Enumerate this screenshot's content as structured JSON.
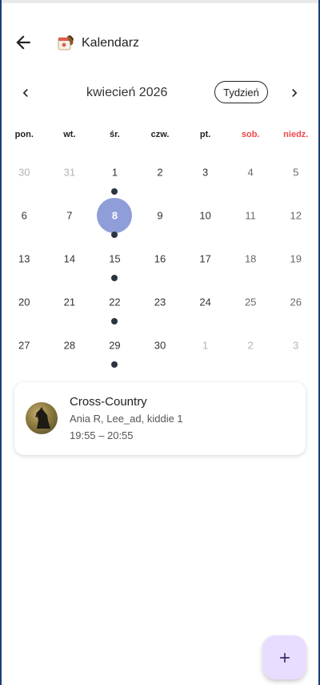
{
  "appbar": {
    "title": "Kalendarz",
    "back_icon": "arrow-back-icon",
    "logo_icon": "calendar-horse-logo"
  },
  "calendar": {
    "month_title": "kwiecień 2026",
    "view_toggle_label": "Tydzień",
    "prev_icon": "chevron-left-icon",
    "next_icon": "chevron-right-icon",
    "weekdays": [
      {
        "label": "pon.",
        "weekend": false
      },
      {
        "label": "wt.",
        "weekend": false
      },
      {
        "label": "śr.",
        "weekend": false
      },
      {
        "label": "czw.",
        "weekend": false
      },
      {
        "label": "pt.",
        "weekend": false
      },
      {
        "label": "sob.",
        "weekend": true
      },
      {
        "label": "niedz.",
        "weekend": true
      }
    ],
    "weeks": [
      [
        {
          "day": "30",
          "muted": true,
          "event": false
        },
        {
          "day": "31",
          "muted": true,
          "event": false
        },
        {
          "day": "1",
          "muted": false,
          "event": true
        },
        {
          "day": "2",
          "muted": false,
          "event": false
        },
        {
          "day": "3",
          "muted": false,
          "event": false
        },
        {
          "day": "4",
          "muted": false,
          "event": false,
          "weekend": true
        },
        {
          "day": "5",
          "muted": false,
          "event": false,
          "weekend": true
        }
      ],
      [
        {
          "day": "6",
          "muted": false,
          "event": false
        },
        {
          "day": "7",
          "muted": false,
          "event": false
        },
        {
          "day": "8",
          "muted": false,
          "event": true,
          "selected": true
        },
        {
          "day": "9",
          "muted": false,
          "event": false
        },
        {
          "day": "10",
          "muted": false,
          "event": false
        },
        {
          "day": "11",
          "muted": false,
          "event": false,
          "weekend": true
        },
        {
          "day": "12",
          "muted": false,
          "event": false,
          "weekend": true
        }
      ],
      [
        {
          "day": "13",
          "muted": false,
          "event": false
        },
        {
          "day": "14",
          "muted": false,
          "event": false
        },
        {
          "day": "15",
          "muted": false,
          "event": true
        },
        {
          "day": "16",
          "muted": false,
          "event": false
        },
        {
          "day": "17",
          "muted": false,
          "event": false
        },
        {
          "day": "18",
          "muted": false,
          "event": false,
          "weekend": true
        },
        {
          "day": "19",
          "muted": false,
          "event": false,
          "weekend": true
        }
      ],
      [
        {
          "day": "20",
          "muted": false,
          "event": false
        },
        {
          "day": "21",
          "muted": false,
          "event": false
        },
        {
          "day": "22",
          "muted": false,
          "event": true
        },
        {
          "day": "23",
          "muted": false,
          "event": false
        },
        {
          "day": "24",
          "muted": false,
          "event": false
        },
        {
          "day": "25",
          "muted": false,
          "event": false,
          "weekend": true
        },
        {
          "day": "26",
          "muted": false,
          "event": false,
          "weekend": true
        }
      ],
      [
        {
          "day": "27",
          "muted": false,
          "event": false
        },
        {
          "day": "28",
          "muted": false,
          "event": false
        },
        {
          "day": "29",
          "muted": false,
          "event": true
        },
        {
          "day": "30",
          "muted": false,
          "event": false
        },
        {
          "day": "1",
          "muted": true,
          "event": false
        },
        {
          "day": "2",
          "muted": true,
          "event": false
        },
        {
          "day": "3",
          "muted": true,
          "event": false
        }
      ]
    ]
  },
  "event": {
    "title": "Cross-Country",
    "participants": "Ania R, Lee_ad, kiddie 1",
    "time": "19:55 – 20:55",
    "avatar_icon": "horse-photo-avatar"
  },
  "fab": {
    "icon": "plus-icon"
  },
  "colors": {
    "selected_day": "#8f9ed9",
    "weekend_label": "#f04848",
    "event_dot": "#2b3440",
    "fab_bg": "#e9ddff"
  }
}
